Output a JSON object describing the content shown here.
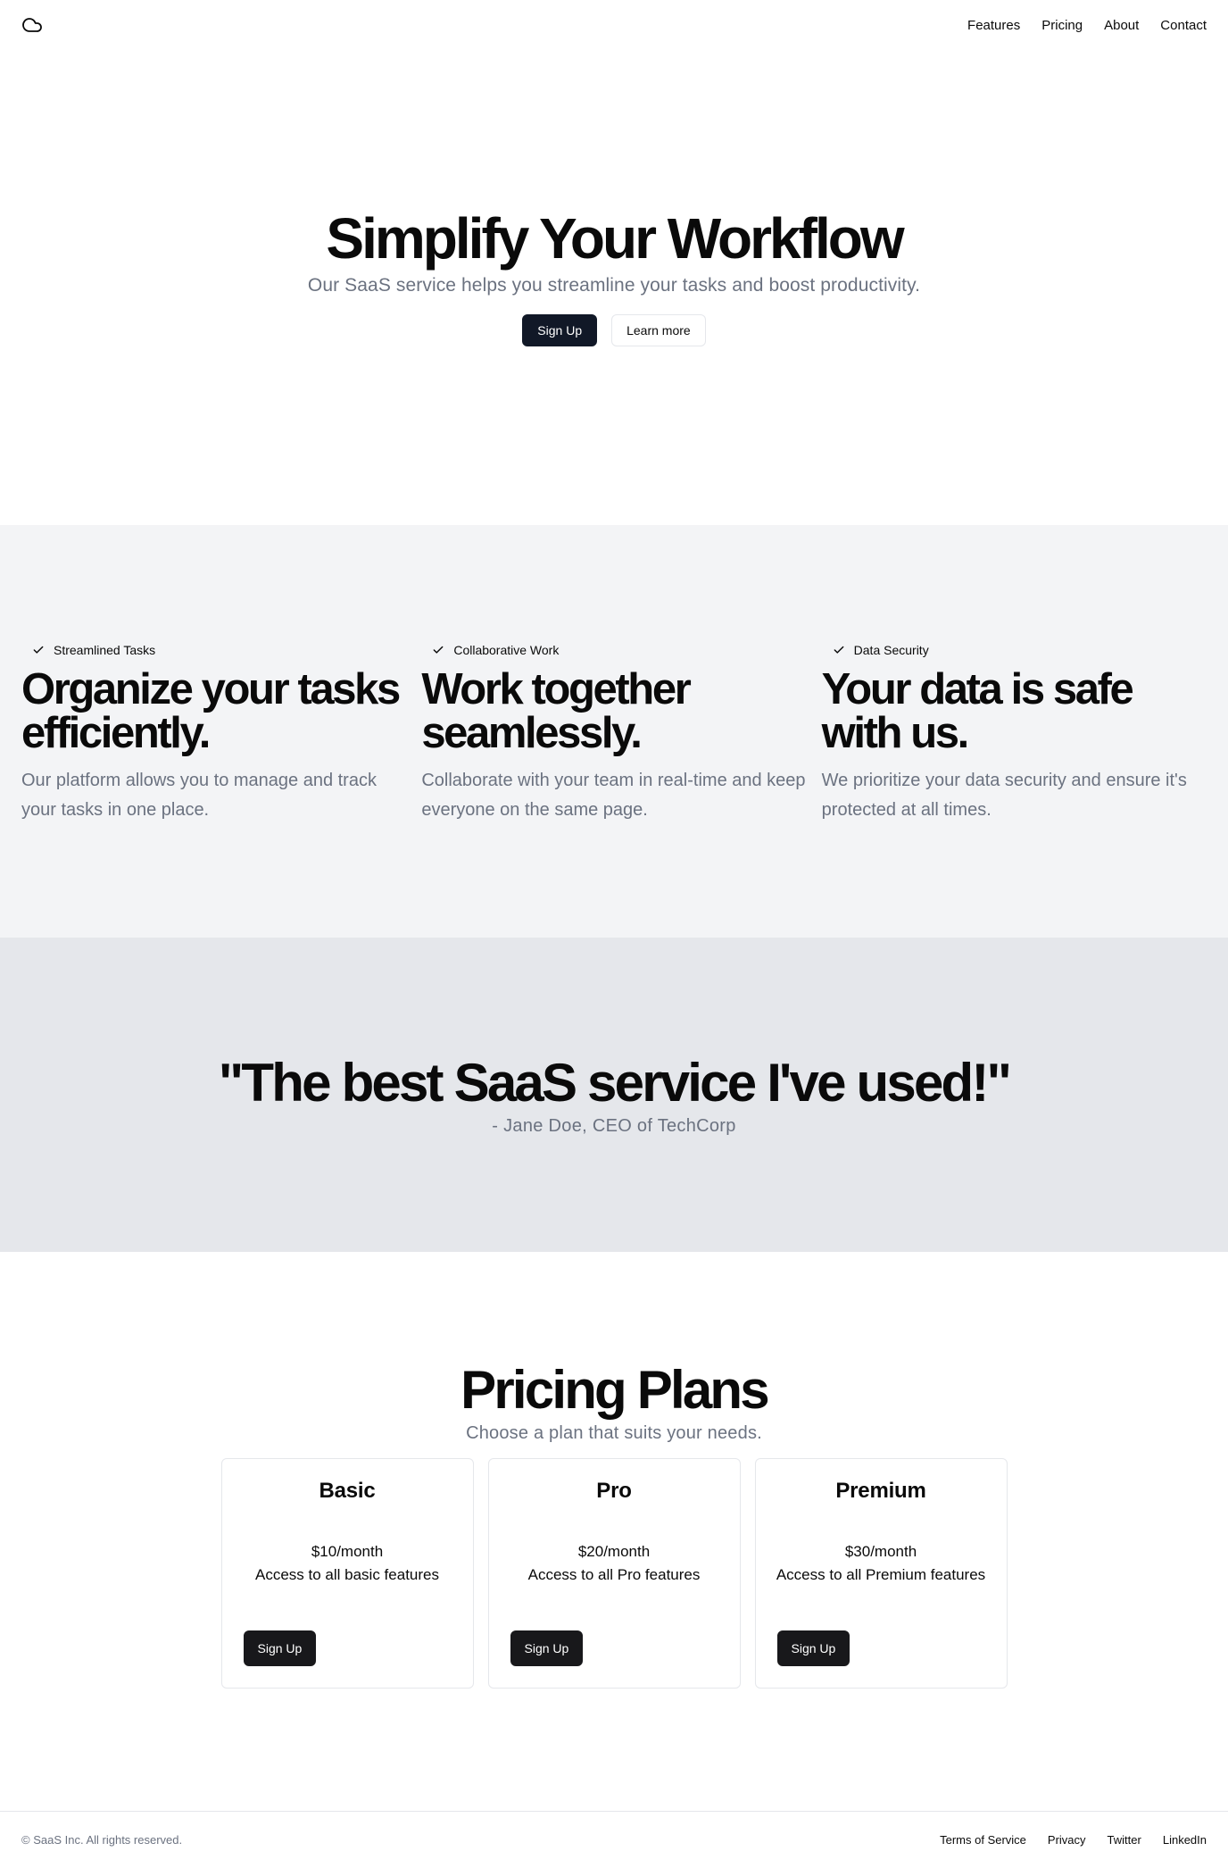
{
  "header": {
    "logo_icon": "cloud-icon",
    "nav": [
      "Features",
      "Pricing",
      "About",
      "Contact"
    ]
  },
  "hero": {
    "title": "Simplify Your Workflow",
    "subtitle": "Our SaaS service helps you streamline your tasks and boost productivity.",
    "primary_button": "Sign Up",
    "secondary_button": "Learn more"
  },
  "features": [
    {
      "tag": "Streamlined Tasks",
      "tag_icon": "check-icon",
      "title": "Organize your tasks efficiently.",
      "description": "Our platform allows you to manage and track your tasks in one place."
    },
    {
      "tag": "Collaborative Work",
      "tag_icon": "check-icon",
      "title": "Work together seamlessly.",
      "description": "Collaborate with your team in real-time and keep everyone on the same page."
    },
    {
      "tag": "Data Security",
      "tag_icon": "check-icon",
      "title": "Your data is safe with us.",
      "description": "We prioritize your data security and ensure it's protected at all times."
    }
  ],
  "testimonial": {
    "quote": "\"The best SaaS service I've used!\"",
    "author": "- Jane Doe, CEO of TechCorp"
  },
  "pricing": {
    "title": "Pricing Plans",
    "subtitle": "Choose a plan that suits your needs.",
    "plans": [
      {
        "name": "Basic",
        "price": "$10/month",
        "description": "Access to all basic features",
        "button": "Sign Up"
      },
      {
        "name": "Pro",
        "price": "$20/month",
        "description": "Access to all Pro features",
        "button": "Sign Up"
      },
      {
        "name": "Premium",
        "price": "$30/month",
        "description": "Access to all Premium features",
        "button": "Sign Up"
      }
    ]
  },
  "footer": {
    "copyright": "© SaaS Inc. All rights reserved.",
    "links": [
      "Terms of Service",
      "Privacy",
      "Twitter",
      "LinkedIn"
    ]
  },
  "colors": {
    "primary_button": "#111827",
    "muted_text": "#6b7280",
    "features_bg": "#f3f4f6",
    "testimonial_bg": "#e5e7eb",
    "border": "#e5e7eb"
  }
}
